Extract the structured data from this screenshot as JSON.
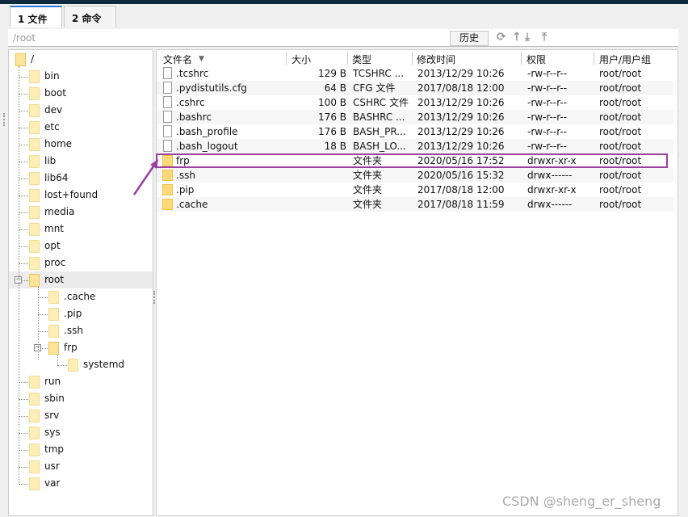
{
  "tabs": [
    {
      "label": "1 文件",
      "active": true
    },
    {
      "label": "2 命令",
      "active": false
    }
  ],
  "path": "/root",
  "toolbar": {
    "history": "历史",
    "icons": [
      "refresh-icon",
      "up-icon",
      "download-icon",
      "upload-icon"
    ]
  },
  "tree": [
    {
      "label": "/",
      "level": 0
    },
    {
      "label": "bin",
      "level": 1
    },
    {
      "label": "boot",
      "level": 1
    },
    {
      "label": "dev",
      "level": 1
    },
    {
      "label": "etc",
      "level": 1
    },
    {
      "label": "home",
      "level": 1
    },
    {
      "label": "lib",
      "level": 1
    },
    {
      "label": "lib64",
      "level": 1
    },
    {
      "label": "lost+found",
      "level": 1
    },
    {
      "label": "media",
      "level": 1
    },
    {
      "label": "mnt",
      "level": 1
    },
    {
      "label": "opt",
      "level": 1
    },
    {
      "label": "proc",
      "level": 1
    },
    {
      "label": "root",
      "level": 1,
      "expanded": true,
      "selected": true
    },
    {
      "label": ".cache",
      "level": 2
    },
    {
      "label": ".pip",
      "level": 2
    },
    {
      "label": ".ssh",
      "level": 2
    },
    {
      "label": "frp",
      "level": 2,
      "expanded": true
    },
    {
      "label": "systemd",
      "level": 3
    },
    {
      "label": "run",
      "level": 1
    },
    {
      "label": "sbin",
      "level": 1
    },
    {
      "label": "srv",
      "level": 1
    },
    {
      "label": "sys",
      "level": 1
    },
    {
      "label": "tmp",
      "level": 1
    },
    {
      "label": "usr",
      "level": 1
    },
    {
      "label": "var",
      "level": 1
    }
  ],
  "columns": [
    "文件名",
    "大小",
    "类型",
    "修改时间",
    "权限",
    "用户/用户组"
  ],
  "files": [
    {
      "name": ".tcshrc",
      "size": "129 B",
      "type": "TCSHRC ...",
      "mtime": "2013/12/29 10:26",
      "perm": "-rw-r--r--",
      "owner": "root/root",
      "dir": false
    },
    {
      "name": ".pydistutils.cfg",
      "size": "64 B",
      "type": "CFG 文件",
      "mtime": "2017/08/18 12:00",
      "perm": "-rw-r--r--",
      "owner": "root/root",
      "dir": false
    },
    {
      "name": ".cshrc",
      "size": "100 B",
      "type": "CSHRC 文件",
      "mtime": "2013/12/29 10:26",
      "perm": "-rw-r--r--",
      "owner": "root/root",
      "dir": false
    },
    {
      "name": ".bashrc",
      "size": "176 B",
      "type": "BASHRC ...",
      "mtime": "2013/12/29 10:26",
      "perm": "-rw-r--r--",
      "owner": "root/root",
      "dir": false
    },
    {
      "name": ".bash_profile",
      "size": "176 B",
      "type": "BASH_PR...",
      "mtime": "2013/12/29 10:26",
      "perm": "-rw-r--r--",
      "owner": "root/root",
      "dir": false
    },
    {
      "name": ".bash_logout",
      "size": "18 B",
      "type": "BASH_LO...",
      "mtime": "2013/12/29 10:26",
      "perm": "-rw-r--r--",
      "owner": "root/root",
      "dir": false
    },
    {
      "name": "frp",
      "size": "",
      "type": "文件夹",
      "mtime": "2020/05/16 17:52",
      "perm": "drwxr-xr-x",
      "owner": "root/root",
      "dir": true,
      "highlighted": true
    },
    {
      "name": ".ssh",
      "size": "",
      "type": "文件夹",
      "mtime": "2020/05/16 15:32",
      "perm": "drwx------",
      "owner": "root/root",
      "dir": true
    },
    {
      "name": ".pip",
      "size": "",
      "type": "文件夹",
      "mtime": "2017/08/18 12:00",
      "perm": "drwxr-xr-x",
      "owner": "root/root",
      "dir": true
    },
    {
      "name": ".cache",
      "size": "",
      "type": "文件夹",
      "mtime": "2017/08/18 11:59",
      "perm": "drwx------",
      "owner": "root/root",
      "dir": true
    }
  ],
  "annotation_color": "#9b3fa0",
  "watermark": "CSDN @sheng_er_sheng"
}
